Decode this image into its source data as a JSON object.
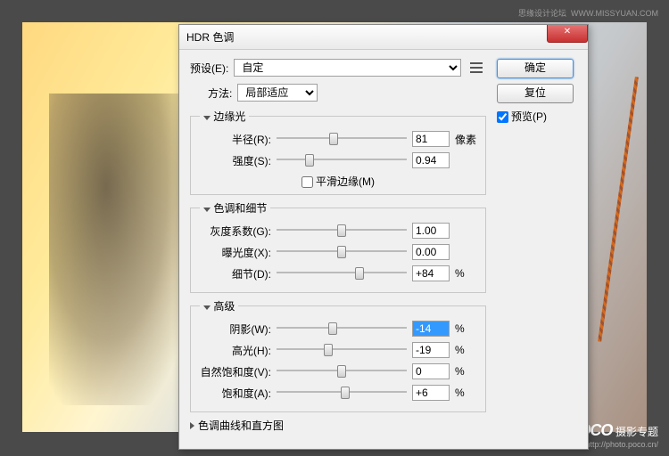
{
  "watermark": {
    "top": "思缘设计论坛",
    "top_url": "WWW.MISSYUAN.COM",
    "br_brand": "POCO",
    "br_text": "摄影专题",
    "br_url": "http://photo.poco.cn/"
  },
  "dialog": {
    "title": "HDR 色调",
    "preset_label": "预设(E):",
    "preset_value": "自定",
    "ok": "确定",
    "reset": "复位",
    "preview": "预览(P)",
    "method_label": "方法:",
    "method_value": "局部适应",
    "sections": {
      "edge": {
        "title": "边缘光",
        "radius": {
          "label": "半径(R):",
          "value": "81",
          "unit": "像素",
          "pos": 44
        },
        "strength": {
          "label": "强度(S):",
          "value": "0.94",
          "unit": "",
          "pos": 25
        },
        "smooth": "平滑边缘(M)"
      },
      "tone": {
        "title": "色调和细节",
        "gamma": {
          "label": "灰度系数(G):",
          "value": "1.00",
          "unit": "",
          "pos": 50
        },
        "exposure": {
          "label": "曝光度(X):",
          "value": "0.00",
          "unit": "",
          "pos": 50
        },
        "detail": {
          "label": "细节(D):",
          "value": "+84",
          "unit": "%",
          "pos": 64
        }
      },
      "adv": {
        "title": "高级",
        "shadow": {
          "label": "阴影(W):",
          "value": "-14",
          "unit": "%",
          "pos": 43
        },
        "highlight": {
          "label": "高光(H):",
          "value": "-19",
          "unit": "%",
          "pos": 40
        },
        "vibrance": {
          "label": "自然饱和度(V):",
          "value": "0",
          "unit": "%",
          "pos": 50
        },
        "saturation": {
          "label": "饱和度(A):",
          "value": "+6",
          "unit": "%",
          "pos": 53
        }
      },
      "curve": {
        "title": "色调曲线和直方图"
      }
    }
  }
}
